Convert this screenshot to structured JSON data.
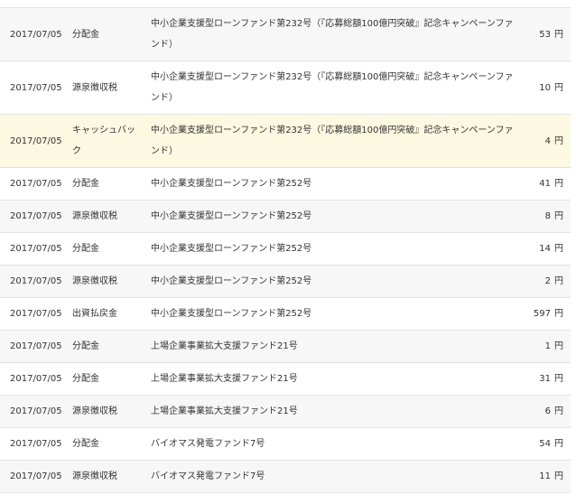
{
  "currency_unit": "円",
  "rows": [
    {
      "date": "2017/07/05",
      "type": "分配金",
      "fund": "中小企業支援型ローンファンド第232号（『応募総額100億円突破』記念キャンペーンファンド）",
      "amount": "53"
    },
    {
      "date": "2017/07/05",
      "type": "源泉徴収税",
      "fund": "中小企業支援型ローンファンド第232号（『応募総額100億円突破』記念キャンペーンファンド）",
      "amount": "10"
    },
    {
      "date": "2017/07/05",
      "type": "キャッシュバック",
      "fund": "中小企業支援型ローンファンド第232号（『応募総額100億円突破』記念キャンペーンファンド）",
      "amount": "4"
    },
    {
      "date": "2017/07/05",
      "type": "分配金",
      "fund": "中小企業支援型ローンファンド第252号",
      "amount": "41"
    },
    {
      "date": "2017/07/05",
      "type": "源泉徴収税",
      "fund": "中小企業支援型ローンファンド第252号",
      "amount": "8"
    },
    {
      "date": "2017/07/05",
      "type": "分配金",
      "fund": "中小企業支援型ローンファンド第252号",
      "amount": "14"
    },
    {
      "date": "2017/07/05",
      "type": "源泉徴収税",
      "fund": "中小企業支援型ローンファンド第252号",
      "amount": "2"
    },
    {
      "date": "2017/07/05",
      "type": "出資払戻金",
      "fund": "中小企業支援型ローンファンド第252号",
      "amount": "597"
    },
    {
      "date": "2017/07/05",
      "type": "分配金",
      "fund": "上場企業事業拡大支援ファンド21号",
      "amount": "1"
    },
    {
      "date": "2017/07/05",
      "type": "分配金",
      "fund": "上場企業事業拡大支援ファンド21号",
      "amount": "31"
    },
    {
      "date": "2017/07/05",
      "type": "源泉徴収税",
      "fund": "上場企業事業拡大支援ファンド21号",
      "amount": "6"
    },
    {
      "date": "2017/07/05",
      "type": "分配金",
      "fund": "バイオマス発電ファンド7号",
      "amount": "54"
    },
    {
      "date": "2017/07/05",
      "type": "源泉徴収税",
      "fund": "バイオマス発電ファンド7号",
      "amount": "11"
    }
  ]
}
